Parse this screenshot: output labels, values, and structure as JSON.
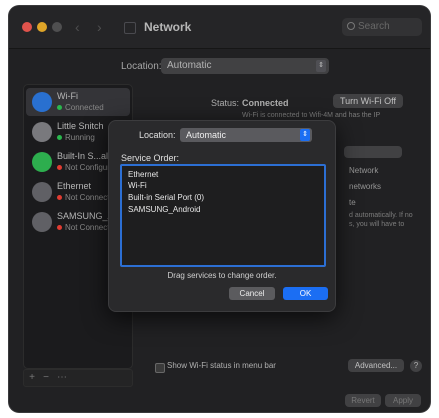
{
  "window": {
    "title": "Network",
    "search_placeholder": "Search"
  },
  "location": {
    "label": "Location:",
    "value": "Automatic"
  },
  "services": [
    {
      "name": "Wi-Fi",
      "status": "Connected",
      "status_color": "#30d158",
      "icon_color": "#2f80ed",
      "selected": true
    },
    {
      "name": "Little Snitch",
      "status": "Running",
      "status_color": "#30d158",
      "icon_color": "#8a8a8f",
      "selected": false
    },
    {
      "name": "Built-In S...al Port (1)",
      "status": "Not Configured",
      "status_color": "#ff453a",
      "icon_color": "#34c759",
      "selected": false
    },
    {
      "name": "Ethernet",
      "status": "Not Connected",
      "status_color": "#ff453a",
      "icon_color": "#6e6e73",
      "selected": false
    },
    {
      "name": "SAMSUNG_Android",
      "status": "Not Connected",
      "status_color": "#ff453a",
      "icon_color": "#6e6e73",
      "selected": false
    }
  ],
  "sidebar_controls": [
    "+",
    "−",
    "⋯"
  ],
  "detail": {
    "status_label": "Status:",
    "status_value": "Connected",
    "turn_off_button": "Turn Wi-Fi Off",
    "status_desc": "Wi-Fi is connected to Wifi-4M and has the IP",
    "network_name_fragment": "Network",
    "remember_fragment": "networks",
    "join_fragment": "te",
    "auto_fragment": "d automatically. If no",
    "will_fragment": "s, you will have to",
    "show_wifi_status": "Show Wi-Fi status in menu bar",
    "advanced_button": "Advanced...",
    "help_icon": "?",
    "revert_button": "Revert",
    "apply_button": "Apply"
  },
  "sheet": {
    "location_label": "Location:",
    "location_value": "Automatic",
    "service_order_label": "Service Order:",
    "items": [
      "Ethernet",
      "Wi-Fi",
      "Built-in Serial Port (0)",
      "SAMSUNG_Android"
    ],
    "hint": "Drag services to change order.",
    "cancel_button": "Cancel",
    "ok_button": "OK"
  },
  "colors": {
    "accent": "#1b6ef3",
    "window_bg": "#262628"
  }
}
